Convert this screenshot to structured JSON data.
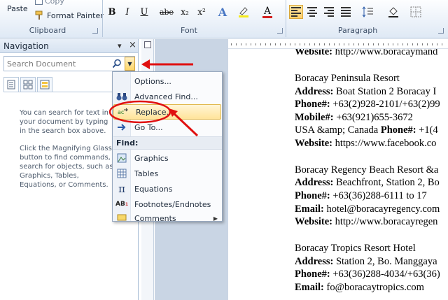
{
  "ribbon": {
    "clipboard": {
      "paste_label": "Paste",
      "copy_label": "Copy",
      "format_painter_label": "Format Painter",
      "group_label": "Clipboard"
    },
    "font": {
      "group_label": "Font",
      "buttons": [
        "B",
        "I",
        "U",
        "abe",
        "x₂",
        "x²",
        "A",
        "A"
      ]
    },
    "paragraph": {
      "group_label": "Paragraph"
    }
  },
  "navigation": {
    "title": "Navigation",
    "pin_glyph": "▾",
    "close_glyph": "×",
    "search_placeholder": "Search Document",
    "help_paragraph_1": "You can search for text in your document by typing in the search box above.",
    "help_paragraph_2": "Click the Magnifying Glass button to find commands, search for objects, such as Graphics, Tables, Equations, or Comments."
  },
  "menu": {
    "items_top": [
      {
        "label": "Options...",
        "icon": "none"
      },
      {
        "label": "Advanced Find...",
        "icon": "binoculars-icon"
      },
      {
        "label": "Replace...",
        "icon": "replace-icon"
      },
      {
        "label": "Go To...",
        "icon": "arrow-right-icon"
      }
    ],
    "find_header": "Find:",
    "items_find": [
      {
        "label": "Graphics",
        "icon": "graphics-icon"
      },
      {
        "label": "Tables",
        "icon": "table-icon"
      },
      {
        "label": "Equations",
        "icon": "pi-icon"
      },
      {
        "label": "Footnotes/Endnotes",
        "icon": "footnote-icon"
      },
      {
        "label": "Comments",
        "icon": "comment-icon"
      }
    ]
  },
  "document": {
    "lines": [
      {
        "bold": "Website:",
        "text": " http://www.boracaymand"
      },
      {
        "bold": "",
        "text": "Boracay Peninsula Resort"
      },
      {
        "bold": "Address:",
        "text": "  Boat Station 2 Boracay I"
      },
      {
        "bold": "Phone#:",
        "text": " +63(2)928-2101/+63(2)99"
      },
      {
        "bold": "Mobile#:",
        "text": " +63(921)655-3672"
      },
      {
        "bold": "",
        "text": "USA &amp; Canada ",
        "bold2": "Phone#:",
        "text2": " +1(4"
      },
      {
        "bold": "Website:",
        "text": " https://www.facebook.co"
      },
      {
        "bold": "",
        "text": "Boracay Regency Beach Resort &a"
      },
      {
        "bold": "Address:",
        "text": "  Beachfront, Station 2, Bo"
      },
      {
        "bold": "Phone#:",
        "text": " +63(36)288-6111 to 17"
      },
      {
        "bold": "Email:",
        "text": " hotel@boracayregency.com"
      },
      {
        "bold": "Website:",
        "text": " http://www.boracayregen"
      },
      {
        "bold": "",
        "text": "Boracay Tropics Resort Hotel"
      },
      {
        "bold": "Address:",
        "text": "  Station 2, Bo. Manggaya"
      },
      {
        "bold": "Phone#:",
        "text": " +63(36)288-4034/+63(36)"
      },
      {
        "bold": "Email:",
        "text": " fo@boracaytropics.com"
      }
    ]
  },
  "colors": {
    "annotation_red": "#e01010",
    "highlight": "#ffe49a",
    "ribbon_bg": "#dfe9f5"
  }
}
